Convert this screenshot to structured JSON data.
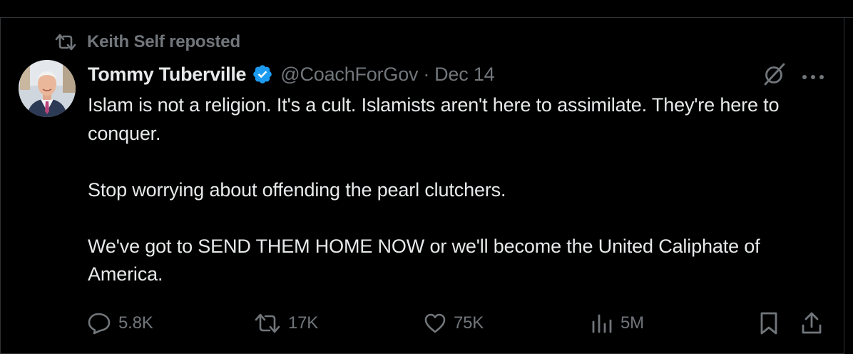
{
  "repost": {
    "text": "Keith Self reposted",
    "icon": "repost-icon"
  },
  "post": {
    "author_name": "Tommy Tuberville",
    "verified": true,
    "handle": "@CoachForGov",
    "separator": "·",
    "date": "Dec 14",
    "avatar_icon": "avatar-photo",
    "paragraphs": [
      "Islam is not a religion. It's a cult. Islamists aren't here to assimilate. They're here to conquer.",
      "Stop worrying about offending the pearl clutchers.",
      "We've got to SEND THEM HOME NOW or we'll become the United Caliphate of America."
    ]
  },
  "actions": {
    "replies": "5.8K",
    "reposts": "17K",
    "likes": "75K",
    "views": "5M"
  },
  "icons": {
    "grok": "grok-icon",
    "more": "more-icon",
    "reply": "reply-icon",
    "repost": "repost-icon",
    "like": "heart-icon",
    "views": "views-icon",
    "bookmark": "bookmark-icon",
    "share": "share-icon"
  },
  "colors": {
    "background": "#000000",
    "text_primary": "#e7e9ea",
    "text_secondary": "#71767b",
    "verified_badge": "#1d9bf0",
    "border": "#2f3336"
  }
}
